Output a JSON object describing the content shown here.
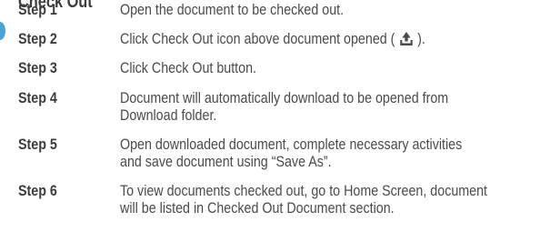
{
  "section": {
    "title": "Check Out",
    "accent_color": "#4aa3d8"
  },
  "steps": [
    {
      "label": "Step 1",
      "lines": [
        "Open the document to be checked out."
      ]
    },
    {
      "label": "Step 2",
      "text_before_icon": "Click Check Out icon above document opened ( ",
      "icon": "upload-icon",
      "text_after_icon": " )."
    },
    {
      "label": "Step 3",
      "lines": [
        "Click Check Out button."
      ]
    },
    {
      "label": "Step 4",
      "lines": [
        "Document will automatically download to be opened from",
        "Download folder."
      ]
    },
    {
      "label": "Step 5",
      "lines": [
        "Open downloaded document, complete necessary activities",
        "and save document using “Save As”."
      ]
    },
    {
      "label": "Step 6",
      "lines": [
        "To view documents checked out, go to Home Screen, document",
        "will be listed in Checked Out Document section."
      ]
    }
  ]
}
